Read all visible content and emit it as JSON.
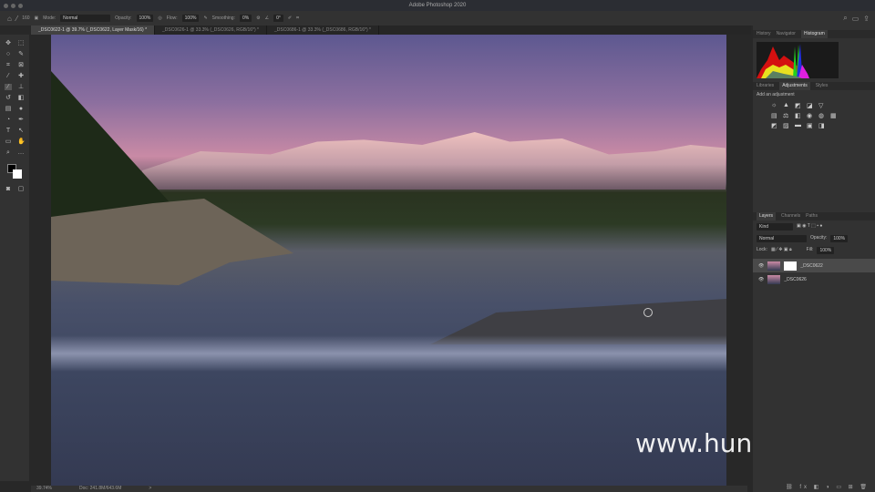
{
  "app": {
    "title": "Adobe Photoshop 2020"
  },
  "options": {
    "mode_label": "Mode:",
    "mode": "Normal",
    "opacity_label": "Opacity:",
    "opacity": "100%",
    "flow_label": "Flow:",
    "flow": "100%",
    "smoothing_label": "Smoothing:",
    "smoothing": "0%",
    "angle": "0°",
    "brush_size": "160"
  },
  "tabs": [
    {
      "label": "_DSC0622-1 @ 39.7% (_DSC0622, Layer Mask/16) *"
    },
    {
      "label": "_DSC0626-1 @ 33.3% (_DSC0626, RGB/16*) *"
    },
    {
      "label": "_DSC0686-1 @ 33.3% (_DSC0686, RGB/16*) *"
    }
  ],
  "status": {
    "zoom": "39.74%",
    "doc": "Doc: 241.8M/643.6M",
    "arrow": ">"
  },
  "watermark": "www.hunls.com",
  "panels": {
    "top_tabs": [
      "History",
      "Navigator",
      "Histogram"
    ],
    "mid_tabs": [
      "Libraries",
      "Adjustments",
      "Styles"
    ],
    "adjust_hint": "Add an adjustment",
    "layer_tabs": [
      "Layers",
      "Channels",
      "Paths"
    ],
    "kind": "Kind",
    "blend": "Normal",
    "opacity_label": "Opacity:",
    "opacity": "100%",
    "lock_label": "Lock:",
    "fill_label": "Fill:",
    "fill": "100%",
    "layers": [
      {
        "name": "_DSC0622",
        "selected": true
      },
      {
        "name": "_DSC0626",
        "selected": false
      }
    ]
  }
}
